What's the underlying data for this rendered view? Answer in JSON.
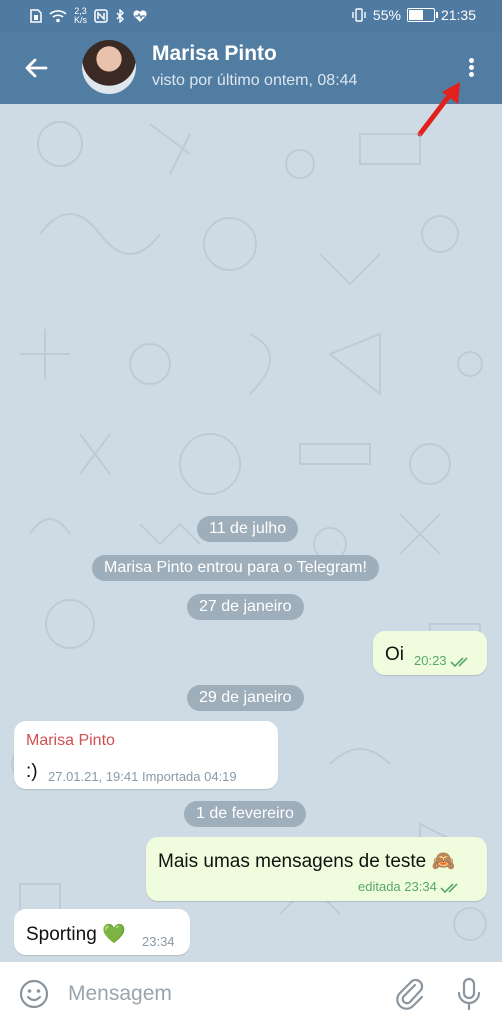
{
  "status_bar": {
    "net_speed_value": "2,3",
    "net_speed_unit": "K/s",
    "battery": "55%",
    "battery_level": 0.55,
    "time": "21:35"
  },
  "header": {
    "title": "Marisa Pinto",
    "subtitle": "visto por último ontem, 08:44"
  },
  "messages": {
    "date_1": "11 de julho",
    "service_1": "Marisa Pinto entrou para o Telegram!",
    "date_2": "27 de janeiro",
    "msg_1": {
      "text": "Oi",
      "time": "20:23"
    },
    "date_3": "29 de janeiro",
    "msg_2": {
      "sender": "Marisa Pinto",
      "text": ":)",
      "meta": "27.01.21, 19:41 Importada 04:19"
    },
    "date_4": "1 de fevereiro",
    "msg_3": {
      "text": "Mais umas mensagens de teste 🙈",
      "meta": "editada 23:34"
    },
    "msg_4": {
      "text": "Sporting 💚",
      "time": "23:34"
    }
  },
  "composer": {
    "placeholder": "Mensagem"
  },
  "colors": {
    "header": "#527da3",
    "chat_background": "#cfdbe4",
    "outgoing_bubble": "#effdde",
    "sender_name": "#d24f4f",
    "annotation_arrow": "#e3211c"
  }
}
